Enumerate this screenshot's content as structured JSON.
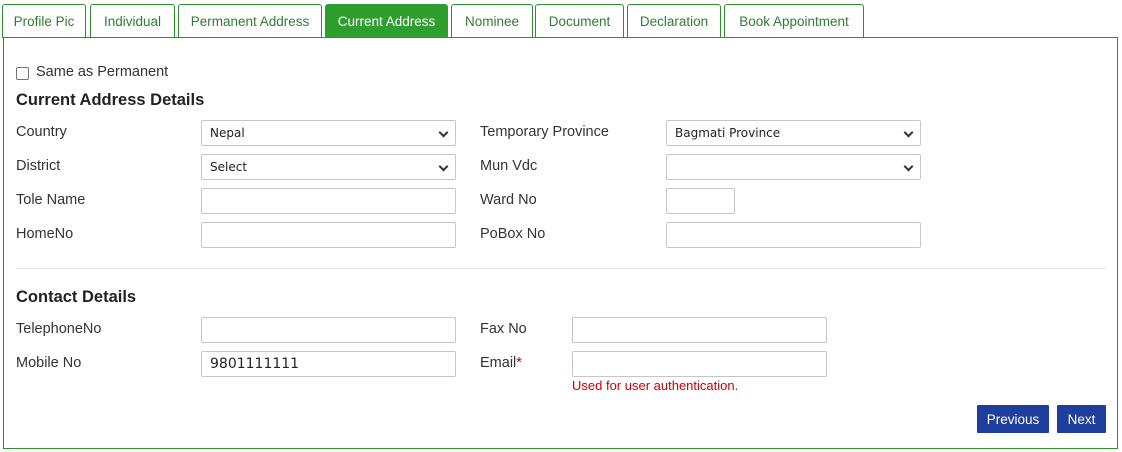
{
  "tabs": [
    {
      "label": "Profile Pic"
    },
    {
      "label": "Individual"
    },
    {
      "label": "Permanent Address"
    },
    {
      "label": "Current Address"
    },
    {
      "label": "Nominee"
    },
    {
      "label": "Document"
    },
    {
      "label": "Declaration"
    },
    {
      "label": "Book Appointment"
    }
  ],
  "active_tab": "Current Address",
  "same_as_permanent": {
    "label": "Same as Permanent",
    "checked": false
  },
  "address": {
    "title": "Current Address Details",
    "country": {
      "label": "Country",
      "value": "Nepal"
    },
    "temp_province": {
      "label": "Temporary Province",
      "value": "Bagmati Province"
    },
    "district": {
      "label": "District",
      "value": "Select"
    },
    "mun_vdc": {
      "label": "Mun Vdc",
      "value": ""
    },
    "tole_name": {
      "label": "Tole Name",
      "value": ""
    },
    "ward_no": {
      "label": "Ward No",
      "value": ""
    },
    "home_no": {
      "label": "HomeNo",
      "value": ""
    },
    "pobox_no": {
      "label": "PoBox No",
      "value": ""
    }
  },
  "contact": {
    "title": "Contact Details",
    "telephone": {
      "label": "TelephoneNo",
      "value": ""
    },
    "fax": {
      "label": "Fax No",
      "value": ""
    },
    "mobile": {
      "label": "Mobile No",
      "value": "9801111111"
    },
    "email": {
      "label": "Email",
      "required_mark": "*",
      "value": "",
      "hint": "Used for user authentication."
    }
  },
  "buttons": {
    "previous": "Previous",
    "next": "Next"
  },
  "colors": {
    "accent_green": "#2e9e2e",
    "button_blue": "#1f3f9e",
    "error_red": "#cc0000"
  }
}
